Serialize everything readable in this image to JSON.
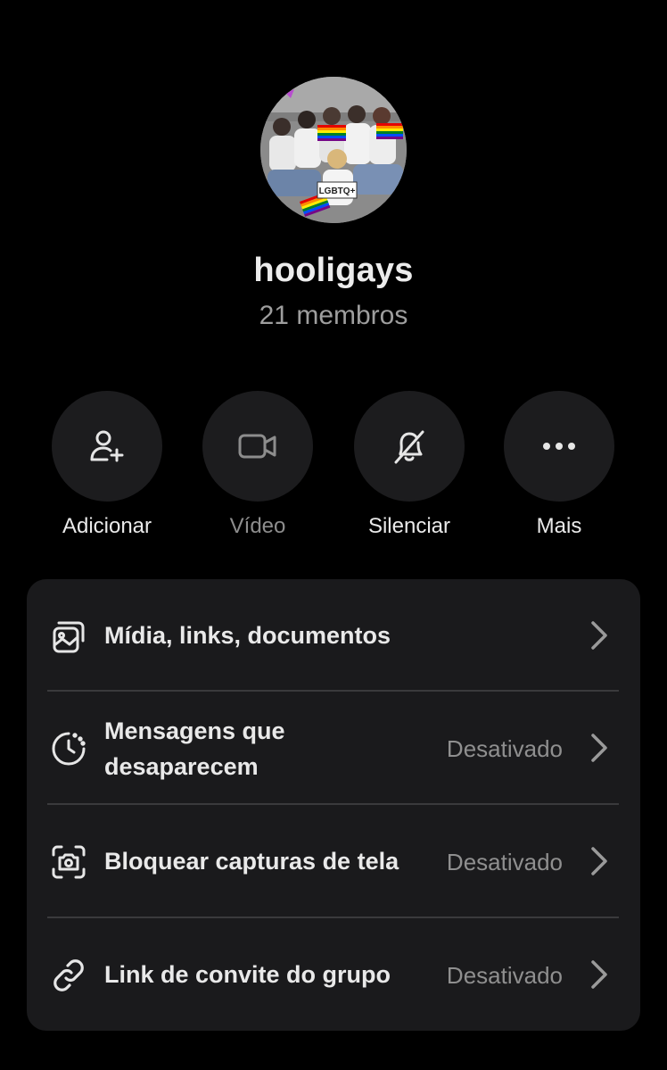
{
  "group": {
    "name": "hooligays",
    "member_count": "21 membros",
    "avatar_badge_text": "LGBTQ+"
  },
  "actions": [
    {
      "label": "Adicionar",
      "icon": "add-person-icon",
      "enabled": true
    },
    {
      "label": "Vídeo",
      "icon": "video-camera-icon",
      "enabled": false
    },
    {
      "label": "Silenciar",
      "icon": "bell-off-icon",
      "enabled": true
    },
    {
      "label": "Mais",
      "icon": "more-icon",
      "enabled": true
    }
  ],
  "settings": [
    {
      "title": "Mídia, links, documentos",
      "status": "",
      "icon": "media-icon"
    },
    {
      "title": "Mensagens que desaparecem",
      "title_line1": "Mensagens que",
      "title_line2": "desaparecem",
      "status": "Desativado",
      "icon": "timer-icon"
    },
    {
      "title": "Bloquear capturas de tela",
      "status": "Desativado",
      "icon": "screenshot-block-icon"
    },
    {
      "title": "Link de convite do grupo",
      "status": "Desativado",
      "icon": "link-icon"
    }
  ],
  "colors": {
    "background": "#000000",
    "surface": "#1a1a1c",
    "button_bg": "#1c1c1e",
    "text_primary": "#e9e9e9",
    "text_secondary": "#8f8f8f",
    "divider": "#3a3a3c"
  }
}
